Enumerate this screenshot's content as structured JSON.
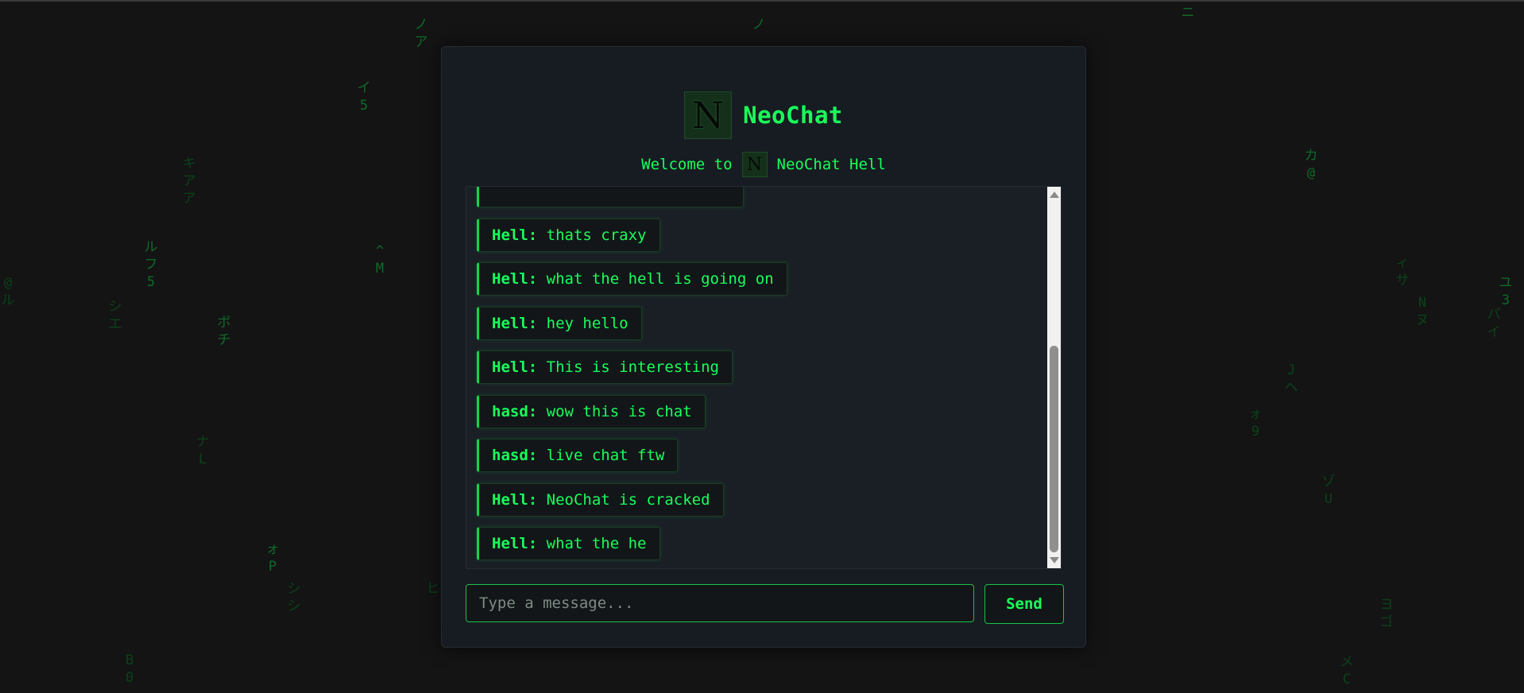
{
  "app": {
    "title": "NeoChat",
    "logo_letter": "N",
    "welcome_prefix": "Welcome to",
    "welcome_suffix": "NeoChat Hell"
  },
  "messages": [
    {
      "author": "Hell:",
      "text": "thats craxy"
    },
    {
      "author": "Hell:",
      "text": "what the hell is going on"
    },
    {
      "author": "Hell:",
      "text": "hey hello"
    },
    {
      "author": "Hell:",
      "text": "This is interesting"
    },
    {
      "author": "hasd:",
      "text": "wow this is chat"
    },
    {
      "author": "hasd:",
      "text": "live chat ftw"
    },
    {
      "author": "Hell:",
      "text": "NeoChat is cracked"
    },
    {
      "author": "Hell:",
      "text": "what the he"
    }
  ],
  "composer": {
    "placeholder": "Type a message...",
    "value": "",
    "send_label": "Send"
  },
  "background_rain": [
    "ノア",
    "イ5",
    "キアア",
    "ルフ5",
    "シエ",
    "ボチ",
    "ナL",
    "ォP",
    "シシ",
    "ヒ",
    "ノ",
    "ニ",
    "カ@",
    "ィサ",
    "Nヌ",
    "パイ",
    "ユ3",
    "Jヘ",
    "ォ9",
    "ゾU",
    "ヨゴ",
    "メC",
    "^M",
    "@ル",
    "B0"
  ],
  "colors": {
    "accent": "#19ff5a",
    "background": "#141414",
    "panel": "#171c22",
    "message_bg": "#121619"
  }
}
